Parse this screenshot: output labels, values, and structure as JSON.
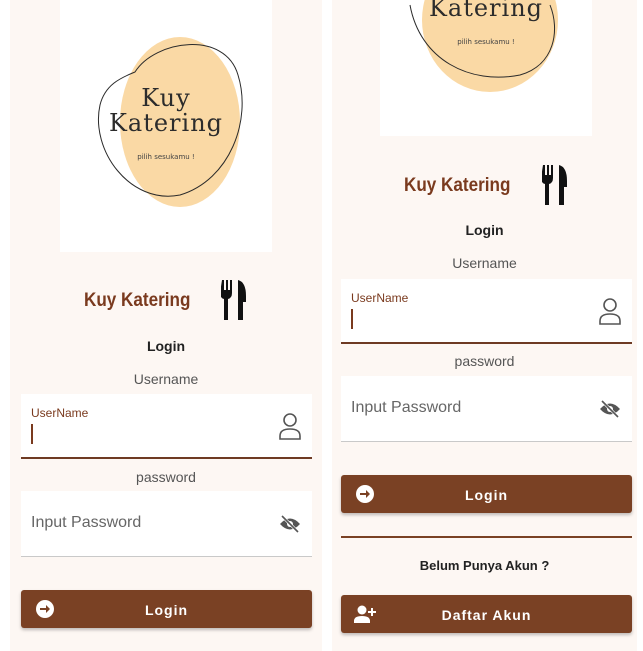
{
  "brand": {
    "logo_title_line1": "Kuy",
    "logo_title_line2": "Katering",
    "logo_tagline": "pilih sesukamu !",
    "name": "Kuy Katering",
    "colors": {
      "primary": "#7a4124",
      "blob": "#fad9a5",
      "background": "#fdf7f3"
    }
  },
  "icons": {
    "brand": "utensils-icon",
    "username": "person-icon",
    "password": "eye-off-icon",
    "login": "arrow-circle-right-icon",
    "register": "person-add-icon"
  },
  "form": {
    "title": "Login",
    "username_label": "Username",
    "username_floating_label": "UserName",
    "password_label": "password",
    "password_placeholder": "Input Password",
    "login_button": "Login"
  },
  "register": {
    "question": "Belum Punya Akun ?",
    "button": "Daftar Akun"
  }
}
